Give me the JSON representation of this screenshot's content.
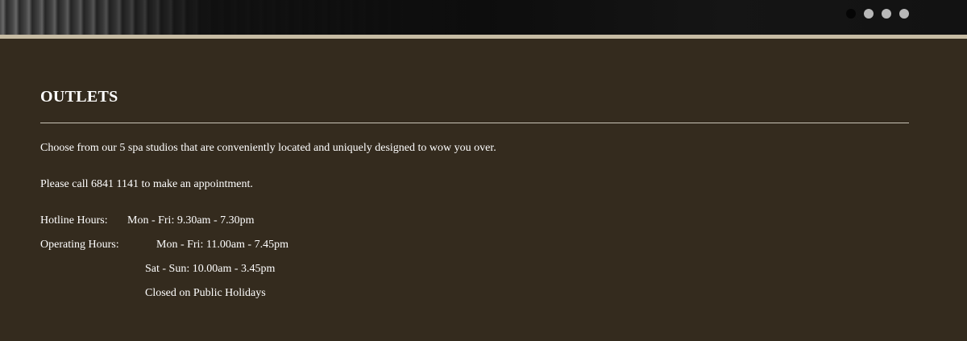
{
  "hero": {
    "carousel_dots": [
      {
        "active": true
      },
      {
        "active": false
      },
      {
        "active": false
      },
      {
        "active": false
      }
    ]
  },
  "outlets": {
    "title": "OUTLETS",
    "intro": "Choose from our 5 spa studios that are conveniently located and uniquely designed to wow you over.",
    "call": "Please call 6841 1141 to make an appointment.",
    "hotline_label": "Hotline Hours:",
    "hotline_value": "Mon - Fri: 9.30am - 7.30pm",
    "operating_label": "Operating Hours:",
    "operating_weekday": "Mon - Fri: 11.00am - 7.45pm",
    "operating_weekend": "Sat - Sun: 10.00am - 3.45pm",
    "operating_note": "Closed on Public Holidays"
  },
  "colors": {
    "background": "#342b1e",
    "border_accent": "#c7bca4",
    "text": "#ffffff"
  }
}
